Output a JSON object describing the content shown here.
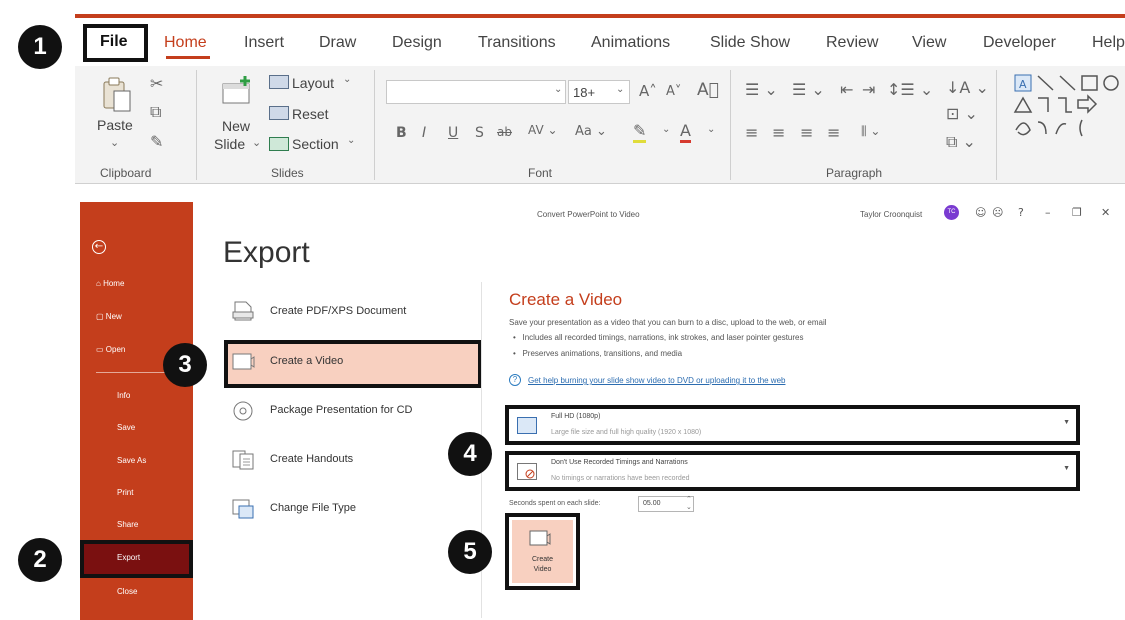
{
  "ribbon": {
    "tabs": [
      "File",
      "Home",
      "Insert",
      "Draw",
      "Design",
      "Transitions",
      "Animations",
      "Slide Show",
      "Review",
      "View",
      "Developer",
      "Help"
    ],
    "active_tab": "Home",
    "clipboard": {
      "paste_label": "Paste",
      "group_label": "Clipboard"
    },
    "slides": {
      "new_label_1": "New",
      "new_label_2": "Slide",
      "layout_label": "Layout",
      "reset_label": "Reset",
      "section_label": "Section",
      "group_label": "Slides"
    },
    "font": {
      "size_value": "18+",
      "group_label": "Font"
    },
    "paragraph": {
      "group_label": "Paragraph"
    },
    "accent_color": "#c43e1c"
  },
  "backstage": {
    "window_title": "Convert PowerPoint to Video",
    "user_name": "Taylor Croonquist",
    "user_initials": "TC",
    "sidebar": {
      "items": [
        {
          "label": "Home",
          "icon": "home-icon"
        },
        {
          "label": "New",
          "icon": "new-document-icon"
        },
        {
          "label": "Open",
          "icon": "folder-open-icon"
        },
        {
          "label": "Info"
        },
        {
          "label": "Save"
        },
        {
          "label": "Save As"
        },
        {
          "label": "Print"
        },
        {
          "label": "Share"
        },
        {
          "label": "Export"
        },
        {
          "label": "Close"
        }
      ],
      "selected": "Export"
    },
    "page_title": "Export",
    "export_options": [
      {
        "label": "Create PDF/XPS Document",
        "icon": "pdf-document-icon"
      },
      {
        "label": "Create a Video",
        "icon": "video-icon"
      },
      {
        "label": "Package Presentation for CD",
        "icon": "cd-icon"
      },
      {
        "label": "Create Handouts",
        "icon": "handouts-icon"
      },
      {
        "label": "Change File Type",
        "icon": "file-type-icon"
      }
    ],
    "selected_option": "Create a Video",
    "create_video": {
      "title": "Create a Video",
      "description": "Save your presentation as a video that you can burn to a disc, upload to the web, or email",
      "bullets": [
        "Includes all recorded timings, narrations, ink strokes, and laser pointer gestures",
        "Preserves animations, transitions, and media"
      ],
      "help_link": "Get help burning your slide show video to DVD or uploading it to the web",
      "quality_dropdown": {
        "main": "Full HD (1080p)",
        "sub": "Large file size and full high quality (1920 x 1080)"
      },
      "timings_dropdown": {
        "main": "Don't Use Recorded Timings and Narrations",
        "sub": "No timings or narrations have been recorded"
      },
      "seconds_label": "Seconds spent on each slide:",
      "seconds_value": "05.00",
      "button_label_1": "Create",
      "button_label_2": "Video"
    }
  },
  "steps": [
    "1",
    "2",
    "3",
    "4",
    "5"
  ]
}
